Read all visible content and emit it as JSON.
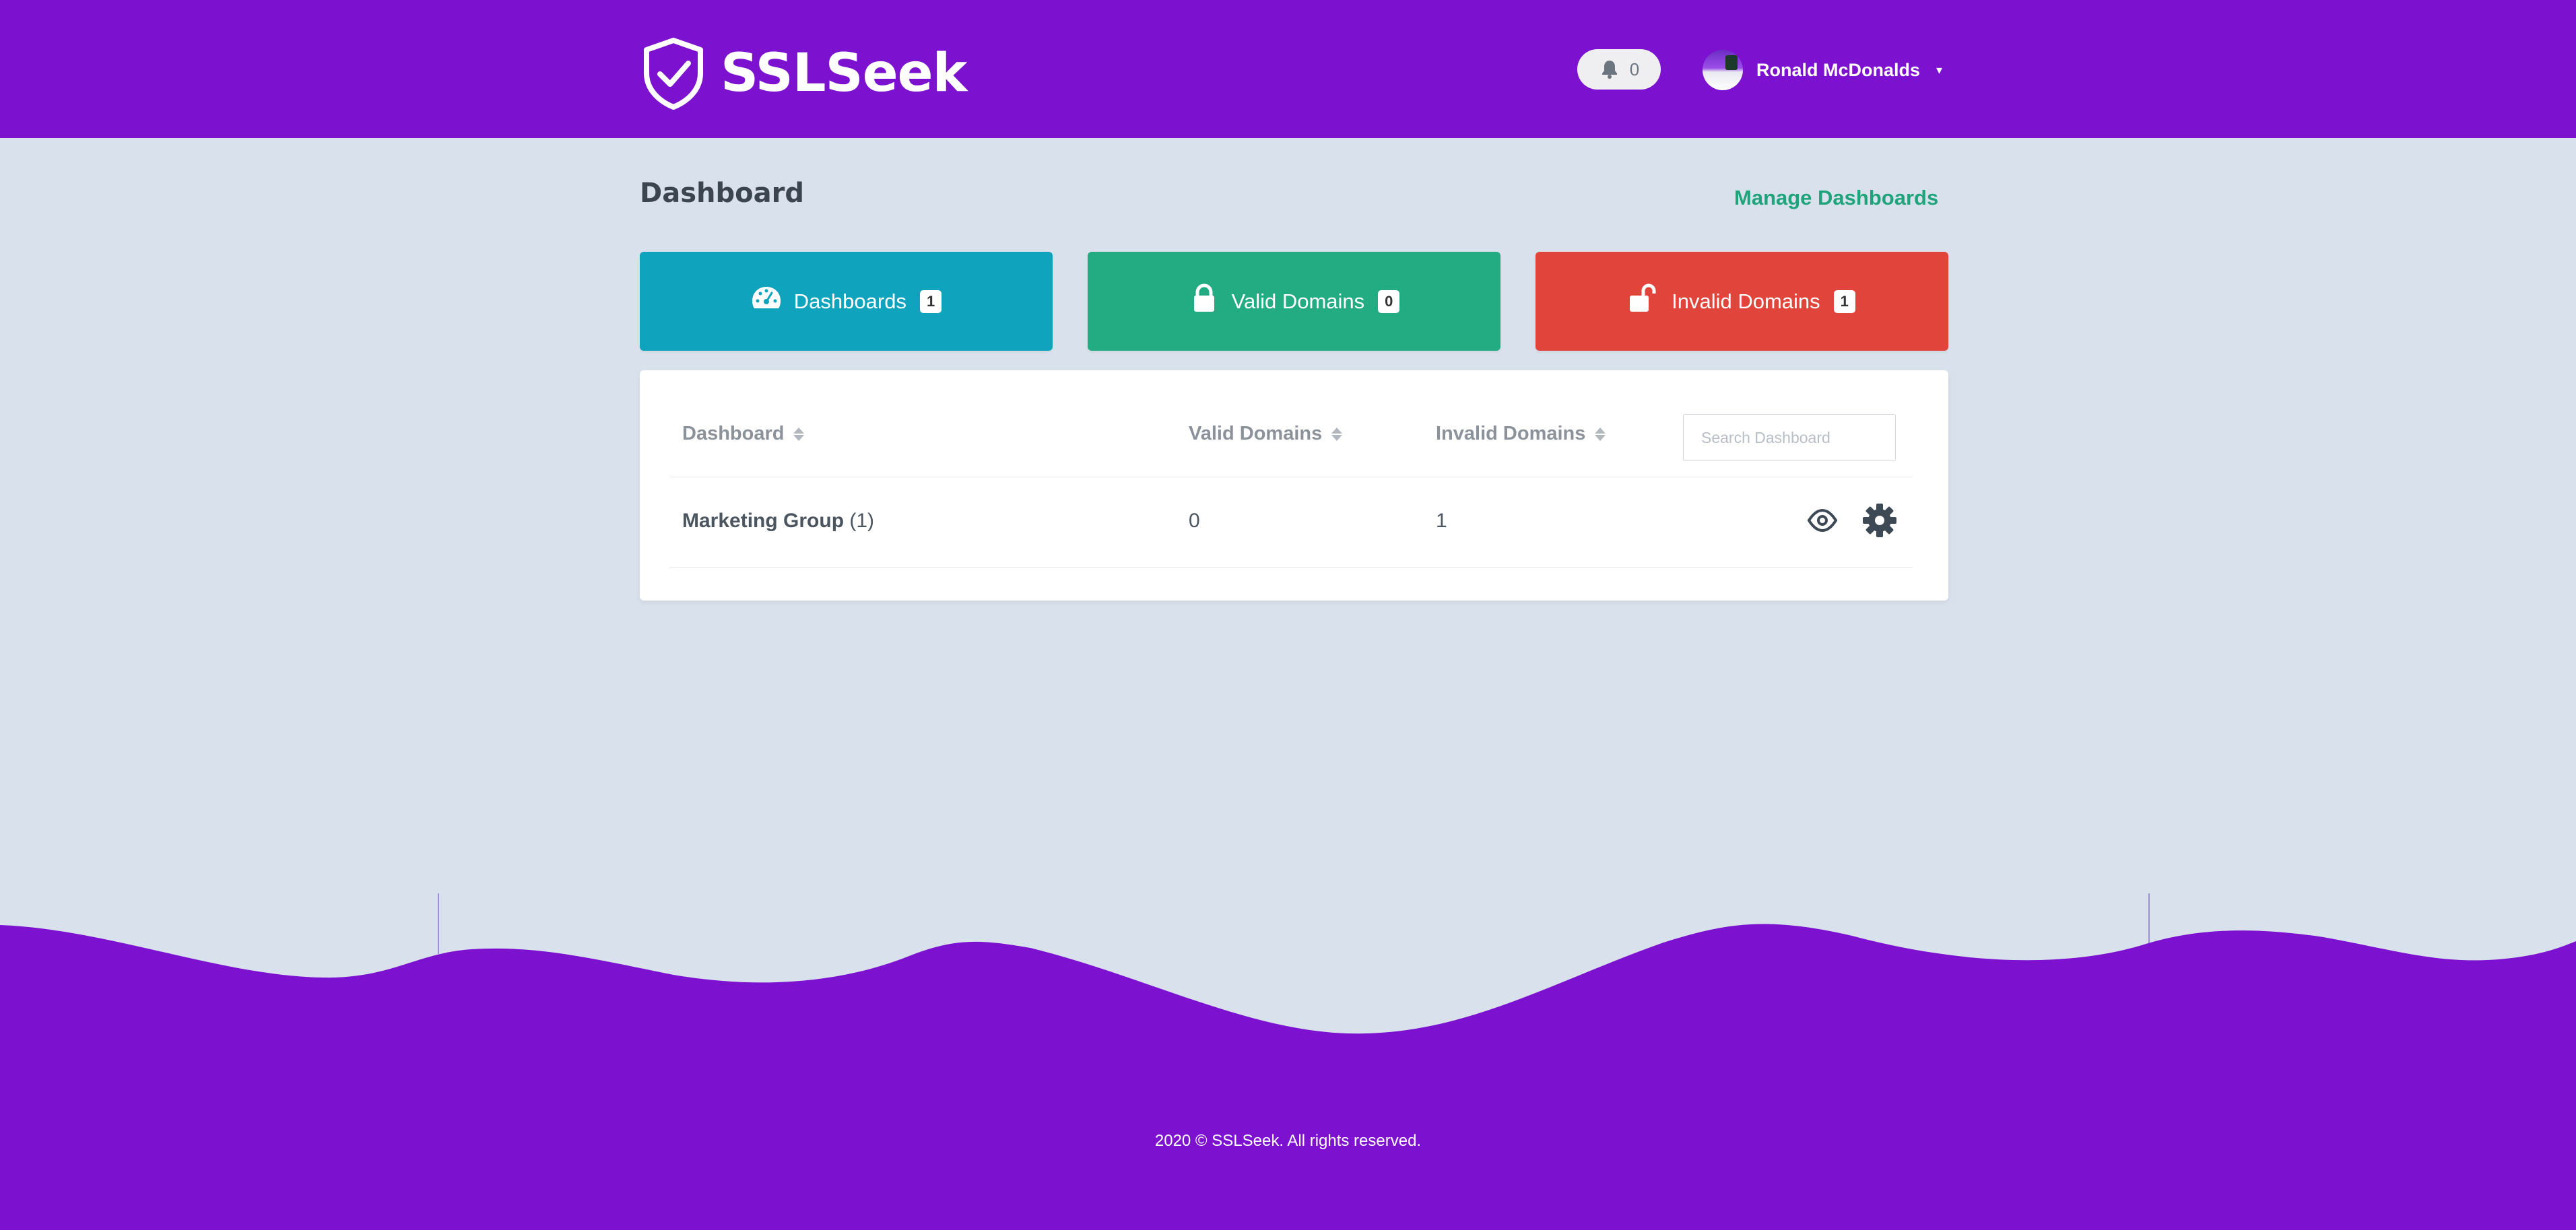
{
  "brand": {
    "name": "SSLSeek"
  },
  "header": {
    "notifications_count": "0",
    "user_name": "Ronald McDonalds"
  },
  "page": {
    "title": "Dashboard",
    "manage_link": "Manage Dashboards"
  },
  "stats": [
    {
      "label": "Dashboards",
      "count": "1",
      "icon": "dashboard-gauge-icon",
      "color": "#0fa3be"
    },
    {
      "label": "Valid Domains",
      "count": "0",
      "icon": "lock-icon",
      "color": "#23ab82"
    },
    {
      "label": "Invalid Domains",
      "count": "1",
      "icon": "unlock-icon",
      "color": "#e0443a"
    }
  ],
  "table": {
    "columns": [
      "Dashboard",
      "Valid Domains",
      "Invalid Domains"
    ],
    "search_placeholder": "Search Dashboard",
    "rows": [
      {
        "name": "Marketing Group",
        "count": "(1)",
        "valid": "0",
        "invalid": "1"
      }
    ]
  },
  "colors": {
    "brand_purple": "#7c11d0",
    "background": "#d9e1ec",
    "accent_green": "#1fa37a"
  },
  "footer": {
    "text": "2020 © SSLSeek. All rights reserved."
  }
}
